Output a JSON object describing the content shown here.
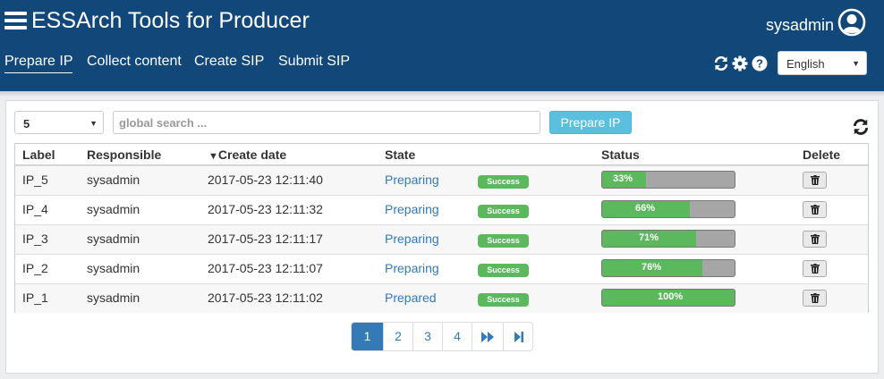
{
  "app": {
    "title": "ESSArch Tools for Producer",
    "username": "sysadmin"
  },
  "nav": {
    "tabs": [
      "Prepare IP",
      "Collect content",
      "Create SIP",
      "Submit SIP"
    ],
    "active_index": 0
  },
  "language": {
    "selected": "English"
  },
  "toolbar": {
    "page_size": "5",
    "search_placeholder": "global search ...",
    "prepare_button": "Prepare IP"
  },
  "table": {
    "columns": {
      "label": "Label",
      "responsible": "Responsible",
      "create_date": "Create date",
      "sort_indicator": "▼",
      "state": "State",
      "status": "Status",
      "delete": "Delete"
    },
    "rows": [
      {
        "label": "IP_5",
        "responsible": "sysadmin",
        "create_date": "2017-05-23 12:11:40",
        "state": "Preparing",
        "badge": "Success",
        "progress": 33,
        "progress_text": "33%"
      },
      {
        "label": "IP_4",
        "responsible": "sysadmin",
        "create_date": "2017-05-23 12:11:32",
        "state": "Preparing",
        "badge": "Success",
        "progress": 66,
        "progress_text": "66%"
      },
      {
        "label": "IP_3",
        "responsible": "sysadmin",
        "create_date": "2017-05-23 12:11:17",
        "state": "Preparing",
        "badge": "Success",
        "progress": 71,
        "progress_text": "71%"
      },
      {
        "label": "IP_2",
        "responsible": "sysadmin",
        "create_date": "2017-05-23 12:11:07",
        "state": "Preparing",
        "badge": "Success",
        "progress": 76,
        "progress_text": "76%"
      },
      {
        "label": "IP_1",
        "responsible": "sysadmin",
        "create_date": "2017-05-23 12:11:02",
        "state": "Prepared",
        "badge": "Success",
        "progress": 100,
        "progress_text": "100%"
      }
    ]
  },
  "pagination": {
    "pages": [
      "1",
      "2",
      "3",
      "4"
    ],
    "active": "1",
    "next_icon": "fast-forward-icon",
    "last_icon": "step-forward-icon"
  },
  "colors": {
    "header": "#12477a",
    "accent": "#337ab7",
    "success": "#5cb85c",
    "info_button": "#5bc0de"
  }
}
